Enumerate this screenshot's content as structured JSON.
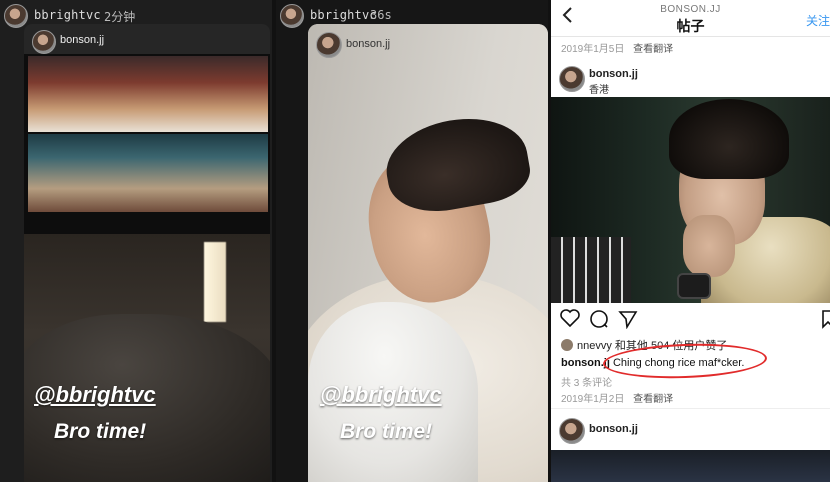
{
  "panel1": {
    "story_user": "bbrightvc",
    "story_time": "2分钟",
    "card_user": "bonson.jj",
    "mention": "@bbrightvc",
    "caption": "Bro time!"
  },
  "panel2": {
    "story_user": "bbrightvc",
    "story_time": "36s",
    "card_user": "bonson.jj",
    "mention": "@bbrightvc",
    "caption": "Bro time!"
  },
  "panel3": {
    "header_sub": "BONSON.JJ",
    "header_title": "帖子",
    "back_icon": "chevron-left-icon",
    "follow_label": "关注",
    "prev_date": "2019年1月5日",
    "prev_translate": "查看翻译",
    "post_user": "bonson.jj",
    "post_location": "香港",
    "likes_text": "nnevvy 和其他 504 位用户赞了",
    "caption_user": "bonson.jj",
    "caption_text": "Ching chong rice maf*cker.",
    "comments_text": "共 3 条评论",
    "post_date": "2019年1月2日",
    "post_translate": "查看翻译",
    "next_user": "bonson.jj",
    "icons": [
      "heart-icon",
      "comment-icon",
      "share-icon",
      "bookmark-icon"
    ]
  },
  "colors": {
    "annotation_red": "#e12b2b",
    "link_blue": "#3897f0"
  }
}
